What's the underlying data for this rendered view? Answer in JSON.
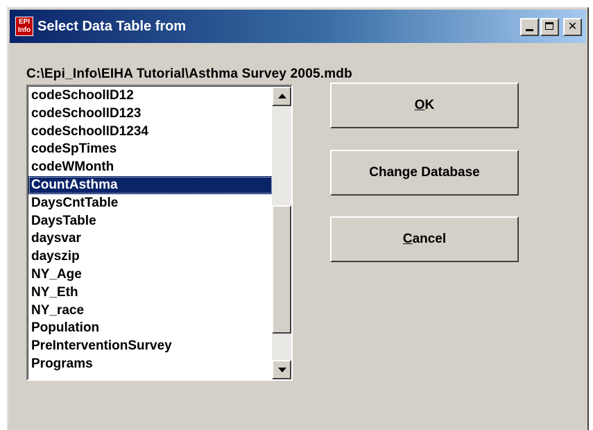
{
  "window": {
    "title": "Select Data Table from",
    "app_icon_text_top": "EPI",
    "app_icon_text_bottom": "Info",
    "buttons": {
      "minimize": "_",
      "maximize": "□",
      "close": "✕"
    }
  },
  "database_path": "C:\\Epi_Info\\EIHA Tutorial\\Asthma Survey 2005.mdb",
  "table_list": {
    "items": [
      "codeSchoolID12",
      "codeSchoolID123",
      "codeSchoolID1234",
      "codeSpTimes",
      "codeWMonth",
      "CountAsthma",
      "DaysCntTable",
      "DaysTable",
      "daysvar",
      "dayszip",
      "NY_Age",
      "NY_Eth",
      "NY_race",
      "Population",
      "PreInterventionSurvey",
      "Programs"
    ],
    "selected": "CountAsthma"
  },
  "buttons": {
    "ok": {
      "accel": "O",
      "rest": "K"
    },
    "change_database": "Change Database",
    "cancel": {
      "accel": "C",
      "rest": "ancel"
    }
  },
  "colors": {
    "title_start": "#0a246a",
    "title_end": "#a6caf0",
    "selection": "#0a246a",
    "face": "#d4d0c8"
  }
}
